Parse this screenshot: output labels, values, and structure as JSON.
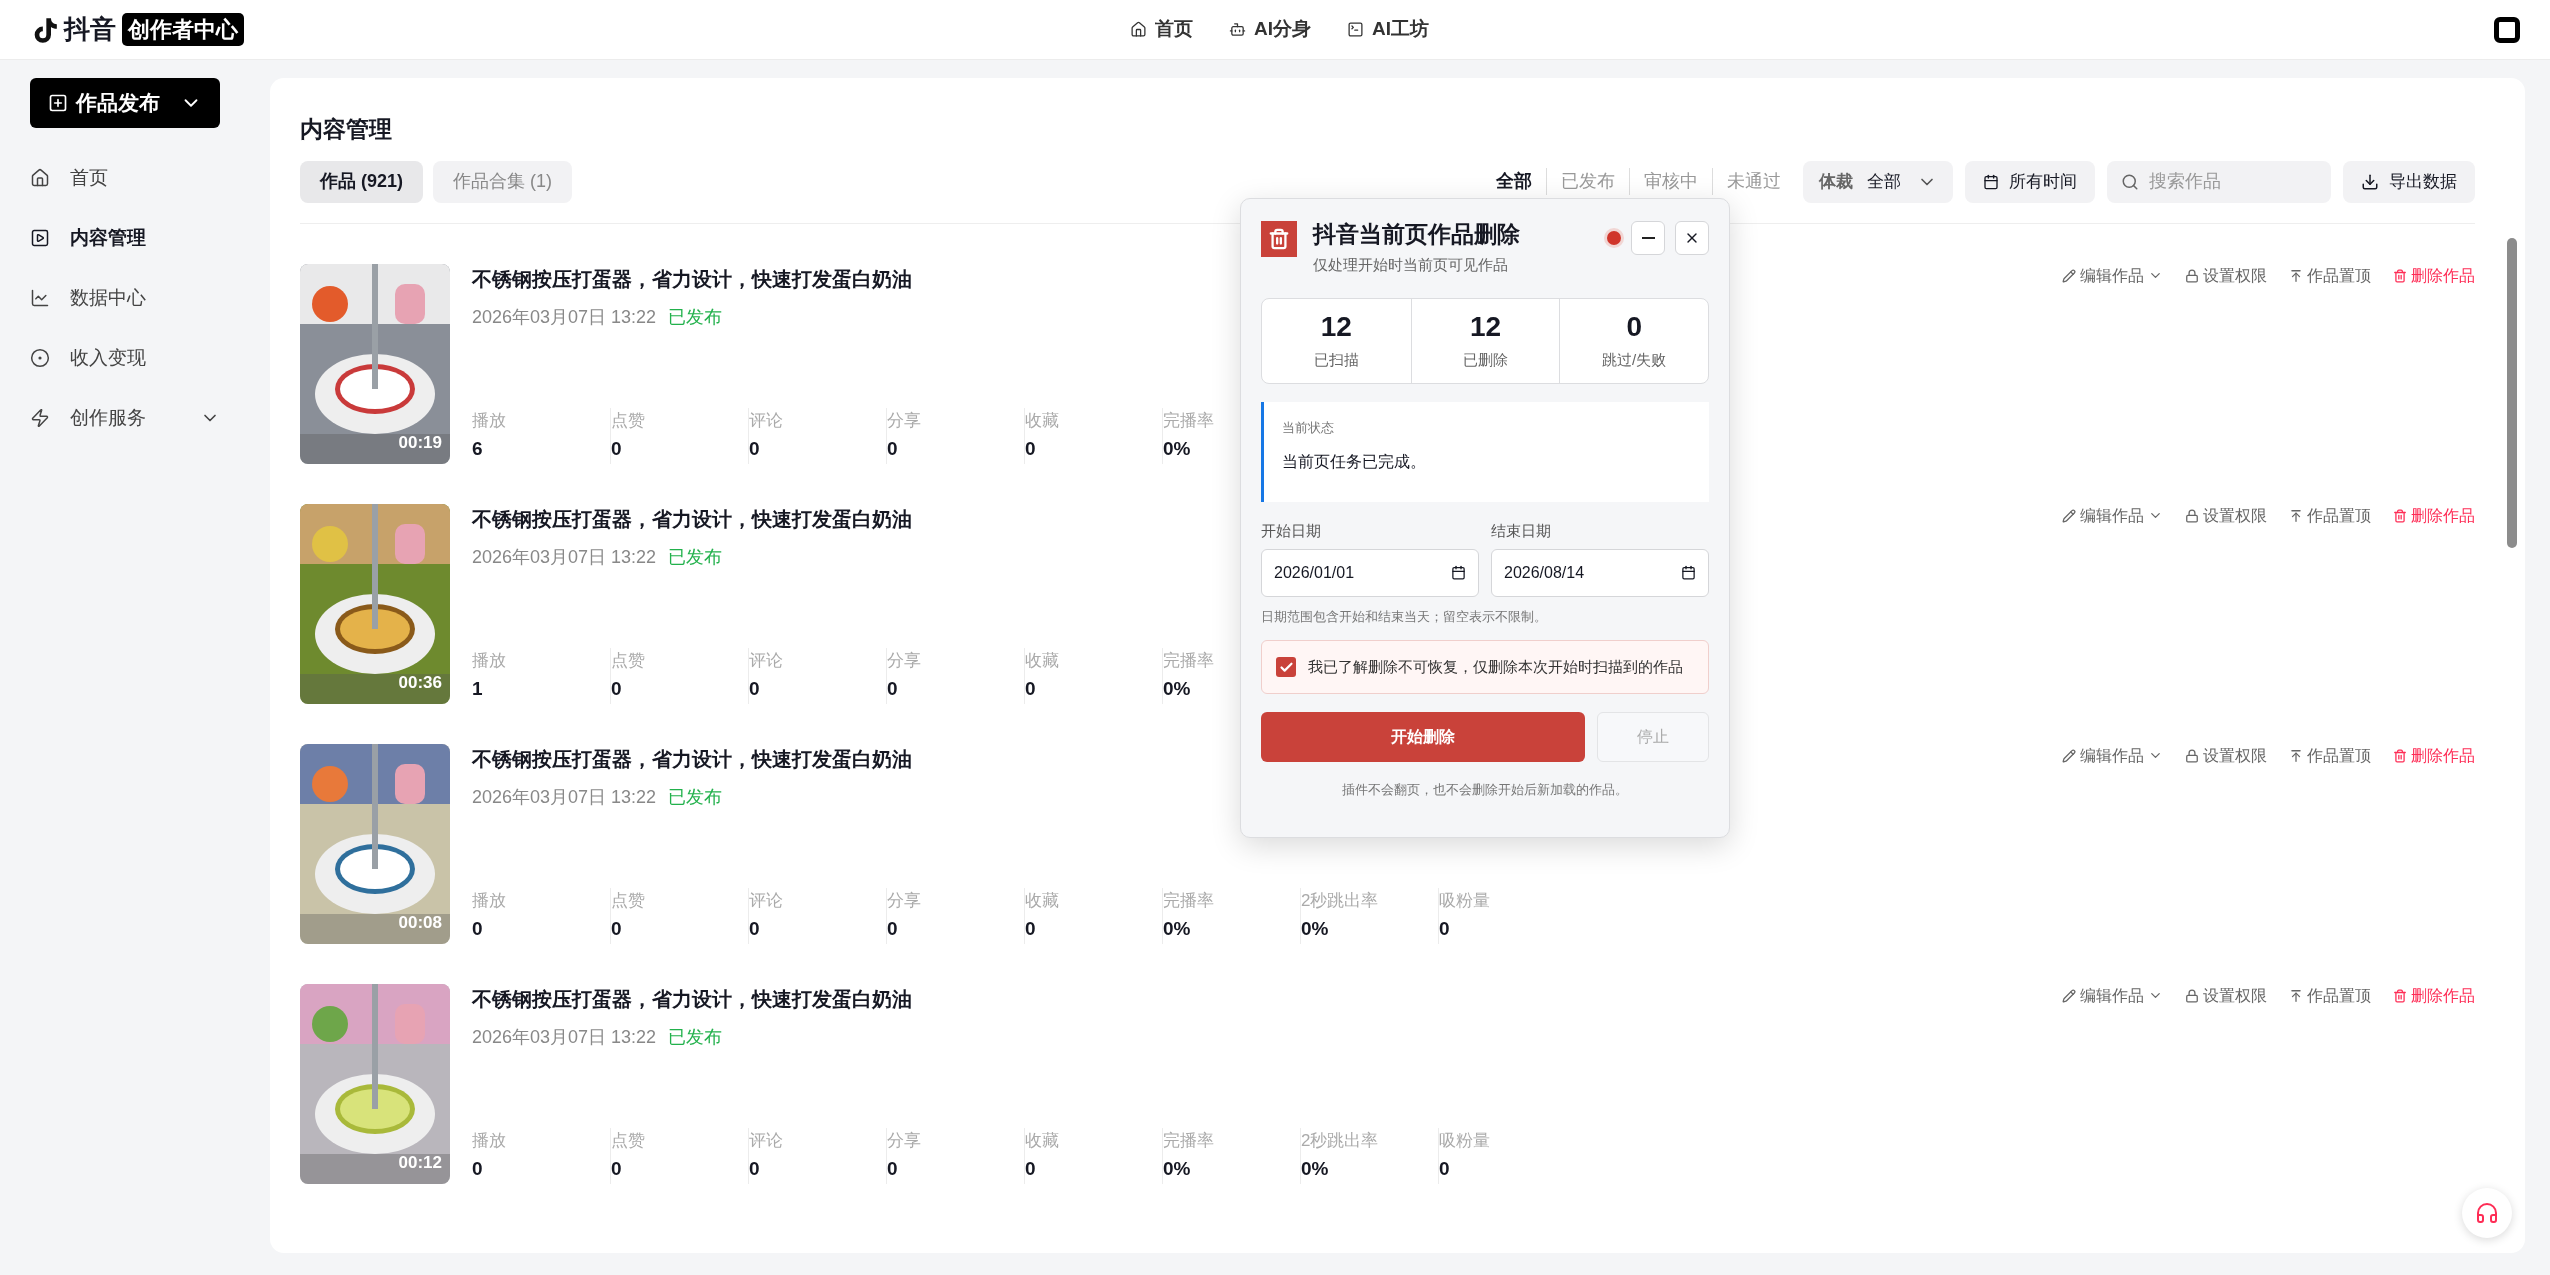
{
  "header": {
    "logo_text": "抖音",
    "logo_badge": "创作者中心",
    "nav": [
      {
        "label": "首页",
        "kind": "home"
      },
      {
        "label": "AI分身",
        "kind": "bot"
      },
      {
        "label": "AI工坊",
        "kind": "workshop"
      }
    ]
  },
  "sidebar": {
    "publish_button": "作品发布",
    "items": [
      {
        "label": "首页",
        "kind": "home",
        "selected": false,
        "expandable": false
      },
      {
        "label": "内容管理",
        "kind": "content",
        "selected": true,
        "expandable": false
      },
      {
        "label": "数据中心",
        "kind": "data",
        "selected": false,
        "expandable": false
      },
      {
        "label": "收入变现",
        "kind": "income",
        "selected": false,
        "expandable": false
      },
      {
        "label": "创作服务",
        "kind": "service",
        "selected": false,
        "expandable": true
      }
    ]
  },
  "content": {
    "title": "内容管理",
    "tabs": [
      {
        "label": "作品 (921)",
        "selected": true
      },
      {
        "label": "作品合集 (1)",
        "selected": false
      }
    ],
    "status_filters": [
      {
        "label": "全部",
        "selected": true
      },
      {
        "label": "已发布",
        "selected": false
      },
      {
        "label": "审核中",
        "selected": false
      },
      {
        "label": "未通过",
        "selected": false
      }
    ],
    "genre_filter": {
      "label": "体裁",
      "value": "全部"
    },
    "time_filter": "所有时间",
    "search": {
      "placeholder": "搜索作品"
    },
    "export_button": "导出数据"
  },
  "works": [
    {
      "title": "不锈钢按压打蛋器，省力设计，快速打发蛋白奶油",
      "date": "2026年03月07日 13:22",
      "status": "已发布",
      "duration": "00:19",
      "stats": [
        {
          "label": "播放",
          "value": "6"
        },
        {
          "label": "点赞",
          "value": "0"
        },
        {
          "label": "评论",
          "value": "0"
        },
        {
          "label": "分享",
          "value": "0"
        },
        {
          "label": "收藏",
          "value": "0"
        },
        {
          "label": "完播率",
          "value": "0%"
        }
      ],
      "actions": [
        {
          "label": "编辑作品",
          "kind": "edit"
        },
        {
          "label": "设置权限",
          "kind": "permission"
        },
        {
          "label": "作品置顶",
          "kind": "pin"
        },
        {
          "label": "删除作品",
          "kind": "delete"
        }
      ]
    },
    {
      "title": "不锈钢按压打蛋器，省力设计，快速打发蛋白奶油",
      "date": "2026年03月07日 13:22",
      "status": "已发布",
      "duration": "00:36",
      "stats": [
        {
          "label": "播放",
          "value": "1"
        },
        {
          "label": "点赞",
          "value": "0"
        },
        {
          "label": "评论",
          "value": "0"
        },
        {
          "label": "分享",
          "value": "0"
        },
        {
          "label": "收藏",
          "value": "0"
        },
        {
          "label": "完播率",
          "value": "0%"
        }
      ],
      "actions": [
        {
          "label": "编辑作品",
          "kind": "edit"
        },
        {
          "label": "设置权限",
          "kind": "permission"
        },
        {
          "label": "作品置顶",
          "kind": "pin"
        },
        {
          "label": "删除作品",
          "kind": "delete"
        }
      ]
    },
    {
      "title": "不锈钢按压打蛋器，省力设计，快速打发蛋白奶油",
      "date": "2026年03月07日 13:22",
      "status": "已发布",
      "duration": "00:08",
      "stats": [
        {
          "label": "播放",
          "value": "0"
        },
        {
          "label": "点赞",
          "value": "0"
        },
        {
          "label": "评论",
          "value": "0"
        },
        {
          "label": "分享",
          "value": "0"
        },
        {
          "label": "收藏",
          "value": "0"
        },
        {
          "label": "完播率",
          "value": "0%"
        },
        {
          "label": "2秒跳出率",
          "value": "0%"
        },
        {
          "label": "吸粉量",
          "value": "0"
        }
      ],
      "actions": [
        {
          "label": "编辑作品",
          "kind": "edit"
        },
        {
          "label": "设置权限",
          "kind": "permission"
        },
        {
          "label": "作品置顶",
          "kind": "pin"
        },
        {
          "label": "删除作品",
          "kind": "delete"
        }
      ]
    },
    {
      "title": "不锈钢按压打蛋器，省力设计，快速打发蛋白奶油",
      "date": "2026年03月07日 13:22",
      "status": "已发布",
      "duration": "00:12",
      "stats": [
        {
          "label": "播放",
          "value": "0"
        },
        {
          "label": "点赞",
          "value": "0"
        },
        {
          "label": "评论",
          "value": "0"
        },
        {
          "label": "分享",
          "value": "0"
        },
        {
          "label": "收藏",
          "value": "0"
        },
        {
          "label": "完播率",
          "value": "0%"
        },
        {
          "label": "2秒跳出率",
          "value": "0%"
        },
        {
          "label": "吸粉量",
          "value": "0"
        }
      ],
      "actions": [
        {
          "label": "编辑作品",
          "kind": "edit"
        },
        {
          "label": "设置权限",
          "kind": "permission"
        },
        {
          "label": "作品置顶",
          "kind": "pin"
        },
        {
          "label": "删除作品",
          "kind": "delete"
        }
      ]
    }
  ],
  "dialog": {
    "title": "抖音当前页作品删除",
    "subtitle": "仅处理开始时当前页可见作品",
    "counters": [
      {
        "value": "12",
        "label": "已扫描"
      },
      {
        "value": "12",
        "label": "已删除"
      },
      {
        "value": "0",
        "label": "跳过/失败"
      }
    ],
    "status_label": "当前状态",
    "status_text": "当前页任务已完成。",
    "start_date": {
      "label": "开始日期",
      "value": "2026/01/01"
    },
    "end_date": {
      "label": "结束日期",
      "value": "2026/08/14"
    },
    "date_hint": "日期范围包含开始和结束当天；留空表示不限制。",
    "confirm": {
      "label": "我已了解删除不可恢复，仅删除本次开始时扫描到的作品",
      "checked": true
    },
    "start_button": "开始删除",
    "stop_button": {
      "label": "停止",
      "disabled": true
    },
    "footnote": "插件不会翻页，也不会删除开始后新加载的作品。"
  }
}
